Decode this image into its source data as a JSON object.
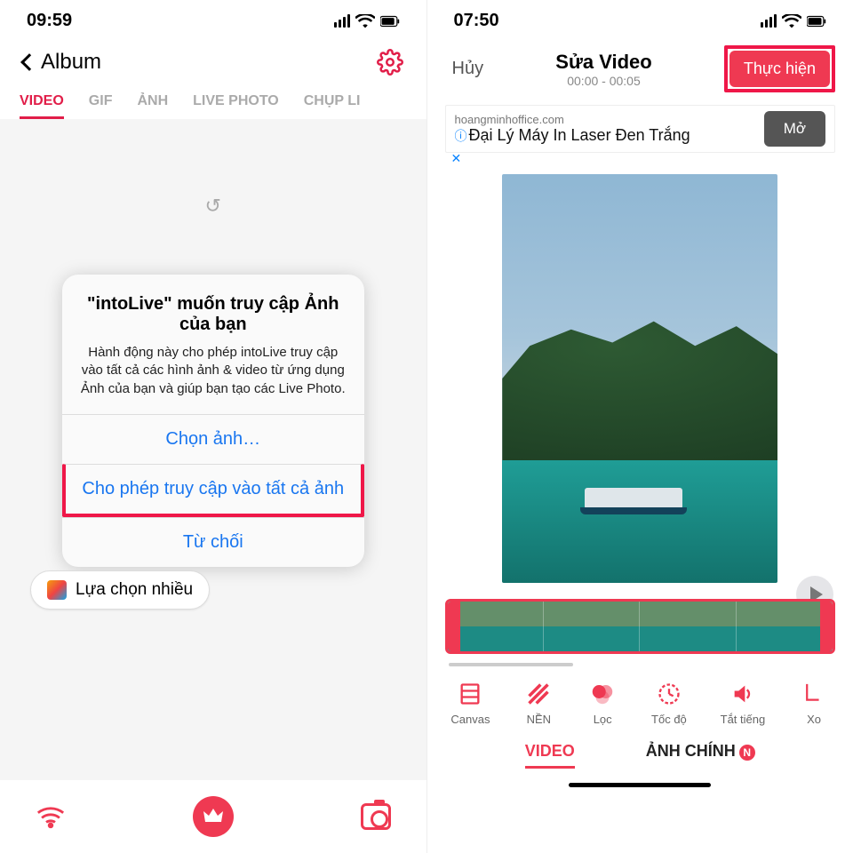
{
  "left": {
    "status_time": "09:59",
    "back_label": "Album",
    "tabs": [
      "VIDEO",
      "GIF",
      "ẢNH",
      "LIVE PHOTO",
      "CHỤP LI"
    ],
    "alert": {
      "title": "\"intoLive\" muốn truy cập Ảnh của bạn",
      "body": "Hành động này cho phép intoLive truy cập vào tất cả các hình ảnh & video từ ứng dụng Ảnh của bạn và giúp bạn tạo các Live Photo.",
      "choose": "Chọn ảnh…",
      "allow_all": "Cho phép truy cập vào tất cả ảnh",
      "deny": "Từ chối"
    },
    "multi_select": "Lựa chọn nhiều"
  },
  "right": {
    "status_time": "07:50",
    "cancel": "Hủy",
    "title": "Sửa Video",
    "range": "00:00 - 00:05",
    "done": "Thực hiện",
    "ad": {
      "domain": "hoangminhoffice.com",
      "headline": "Đại Lý Máy In Laser Đen Trắng",
      "cta": "Mở"
    },
    "tools": [
      "Canvas",
      "NỀN",
      "Lọc",
      "Tốc độ",
      "Tắt tiếng",
      "Xo"
    ],
    "btab_a": "VIDEO",
    "btab_b": "ẢNH CHÍNH",
    "nbadge": "N"
  }
}
